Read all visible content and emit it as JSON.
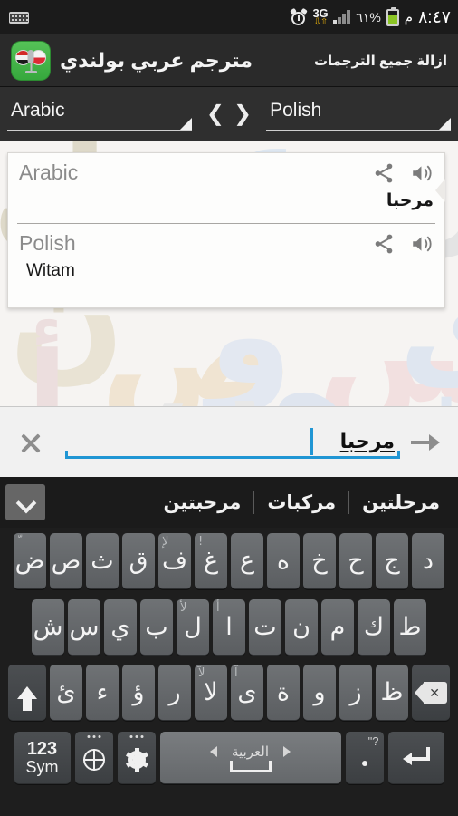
{
  "statusbar": {
    "keyboard_icon": "keyboard-icon",
    "alarm_icon": "alarm-icon",
    "network": "3G",
    "battery_percent": "٦١%",
    "am_pm": "م",
    "time": "٨:٤٧"
  },
  "actionbar": {
    "app_icon": "app-logo-icon",
    "title": "مترجم عربي بولندي",
    "clear_all_label": "ازالة جميع الترجمات"
  },
  "langbar": {
    "source_language": "Arabic",
    "target_language": "Polish",
    "swap_left": "❮",
    "swap_right": "❯"
  },
  "card": {
    "source": {
      "language_label": "Arabic",
      "text": "مرحبا",
      "share_icon": "share-icon",
      "speak_icon": "speaker-icon"
    },
    "target": {
      "language_label": "Polish",
      "text": "Witam",
      "share_icon": "share-icon",
      "speak_icon": "speaker-icon"
    }
  },
  "input": {
    "clear_icon": "close-icon",
    "value": "مرحبا",
    "submit_icon": "arrow-right-icon"
  },
  "keyboard": {
    "suggestions": [
      "مرحلتين",
      "مركبات",
      "مرحبتين"
    ],
    "expand_icon": "chevron-down-icon",
    "row1": [
      {
        "main": "ض",
        "alt": "ّ"
      },
      {
        "main": "ص",
        "alt": ""
      },
      {
        "main": "ث",
        "alt": ""
      },
      {
        "main": "ق",
        "alt": ""
      },
      {
        "main": "ف",
        "alt": "ﻹ"
      },
      {
        "main": "غ",
        "alt": "!"
      },
      {
        "main": "ع",
        "alt": ""
      },
      {
        "main": "ه",
        "alt": ""
      },
      {
        "main": "خ",
        "alt": ""
      },
      {
        "main": "ح",
        "alt": ""
      },
      {
        "main": "ج",
        "alt": ""
      },
      {
        "main": "د",
        "alt": ""
      }
    ],
    "row2": [
      {
        "main": "ش",
        "alt": ""
      },
      {
        "main": "س",
        "alt": ""
      },
      {
        "main": "ي",
        "alt": ""
      },
      {
        "main": "ب",
        "alt": ""
      },
      {
        "main": "ل",
        "alt": "ﻷ"
      },
      {
        "main": "ا",
        "alt": "أ"
      },
      {
        "main": "ت",
        "alt": ""
      },
      {
        "main": "ن",
        "alt": ""
      },
      {
        "main": "م",
        "alt": ""
      },
      {
        "main": "ك",
        "alt": ""
      },
      {
        "main": "ط",
        "alt": ""
      }
    ],
    "row3": [
      {
        "main": "ئ",
        "alt": ""
      },
      {
        "main": "ء",
        "alt": ""
      },
      {
        "main": "ؤ",
        "alt": ""
      },
      {
        "main": "ر",
        "alt": ""
      },
      {
        "main": "لا",
        "alt": "ﻵ"
      },
      {
        "main": "ى",
        "alt": "آ"
      },
      {
        "main": "ة",
        "alt": ""
      },
      {
        "main": "و",
        "alt": ""
      },
      {
        "main": "ز",
        "alt": ""
      },
      {
        "main": "ظ",
        "alt": ""
      }
    ],
    "shift_icon": "shift-icon",
    "backspace_icon": "backspace-icon",
    "sym_key_line1": "123",
    "sym_key_line2": "Sym",
    "globe_icon": "globe-icon",
    "settings_icon": "gear-icon",
    "space_label": "العربية",
    "space_prev_icon": "arrow-left-icon",
    "space_next_icon": "arrow-right-icon",
    "period_key": ".",
    "period_alt": "\"?",
    "enter_icon": "enter-icon"
  },
  "colors": {
    "accent_blue": "#2196d4",
    "app_green": "#45b34a",
    "battery_green": "#8bc524",
    "key_face": "#6f7275"
  }
}
